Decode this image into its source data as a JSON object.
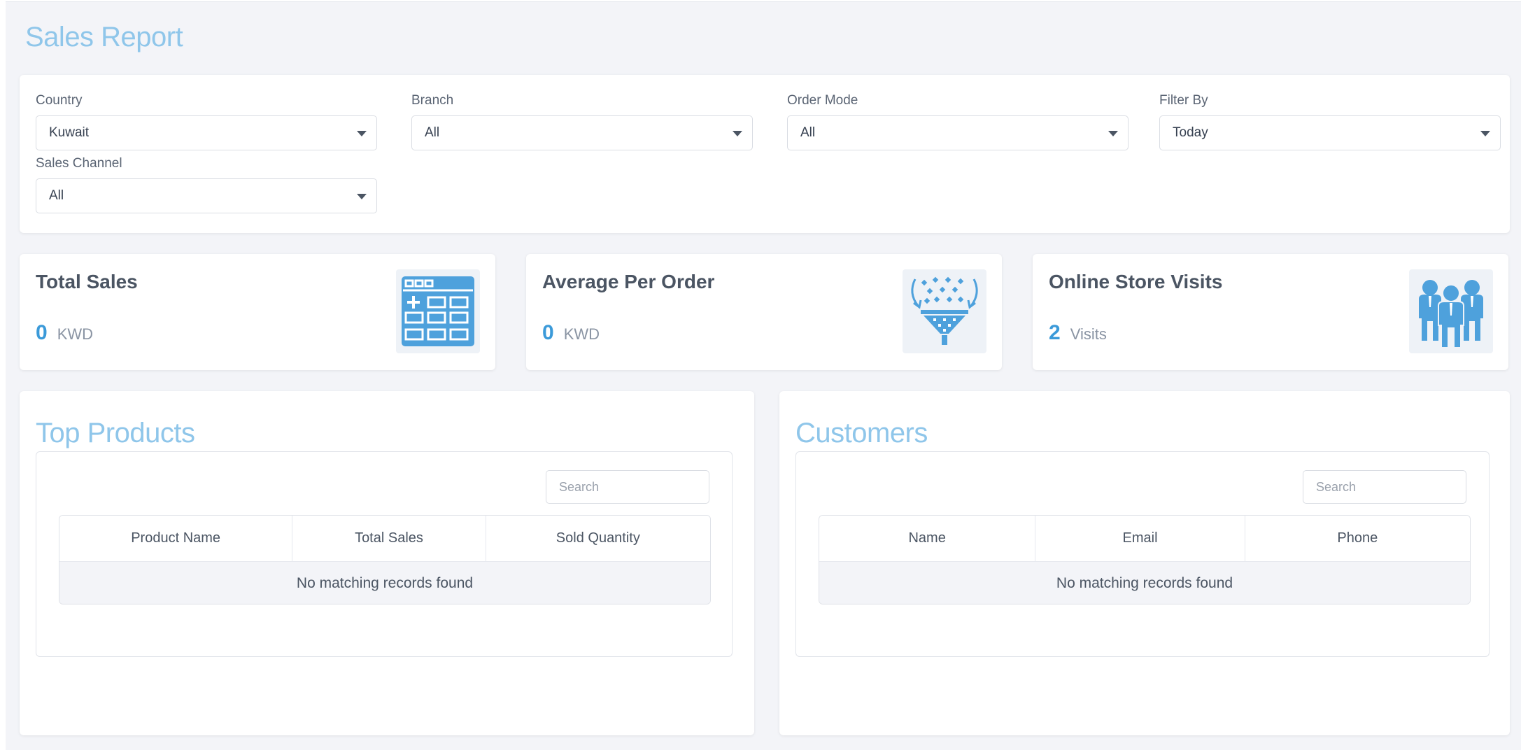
{
  "page": {
    "title": "Sales Report"
  },
  "filters": {
    "country": {
      "label": "Country",
      "value": "Kuwait"
    },
    "branch": {
      "label": "Branch",
      "value": "All"
    },
    "order_mode": {
      "label": "Order Mode",
      "value": "All"
    },
    "filter_by": {
      "label": "Filter By",
      "value": "Today"
    },
    "sales_channel": {
      "label": "Sales Channel",
      "value": "All"
    }
  },
  "stats": {
    "total_sales": {
      "title": "Total Sales",
      "value": "0",
      "unit": "KWD",
      "icon": "calculator-icon"
    },
    "average_per_order": {
      "title": "Average Per Order",
      "value": "0",
      "unit": "KWD",
      "icon": "funnel-icon"
    },
    "online_store_visits": {
      "title": "Online Store Visits",
      "value": "2",
      "unit": "Visits",
      "icon": "people-icon"
    }
  },
  "top_products": {
    "title": "Top Products",
    "search_placeholder": "Search",
    "columns": [
      "Product Name",
      "Total Sales",
      "Sold Quantity"
    ],
    "empty_message": "No matching records found"
  },
  "customers": {
    "title": "Customers",
    "search_placeholder": "Search",
    "columns": [
      "Name",
      "Email",
      "Phone"
    ],
    "empty_message": "No matching records found"
  },
  "colors": {
    "accent": "#3b9ad9",
    "title": "#8fc6ea",
    "icon": "#4ea1dc",
    "background": "#f3f4f8"
  }
}
